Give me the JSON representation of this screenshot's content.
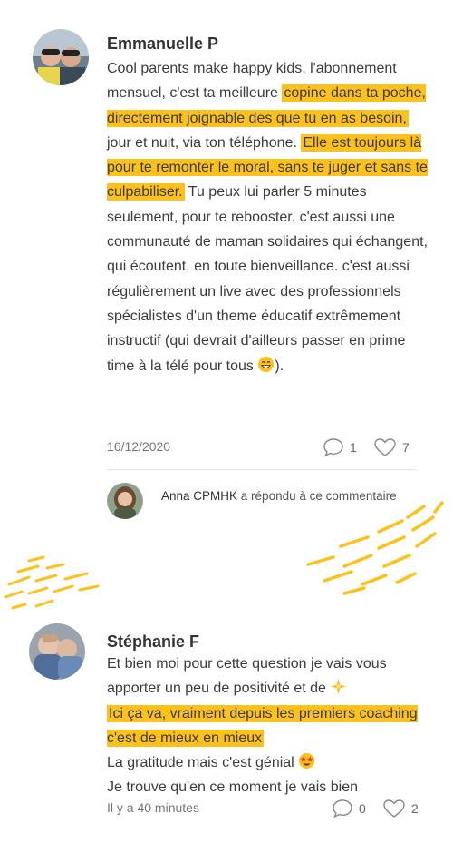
{
  "comments": [
    {
      "author": "Emmanuelle P",
      "segments": [
        {
          "t": "Cool parents make happy kids, l'abonnement mensuel, c'est ta meilleure ",
          "hl": false
        },
        {
          "t": "copine dans ta poche, directement joignable des que tu en as besoin,",
          "hl": true
        },
        {
          "t": " jour et nuit, via ton téléphone. ",
          "hl": false
        },
        {
          "t": "Elle est toujours là pour te remonter le moral, sans te juger et sans te culpabiliser.",
          "hl": true
        },
        {
          "t": " Tu peux lui parler 5 minutes seulement, pour te rebooster. c'est aussi une communauté de maman solidaires qui échangent, qui écoutent, en toute bienveillance. c'est aussi régulièrement un live avec des professionnels spécialistes d'un theme éducatif extrêmement instructif (qui devrait d'ailleurs passer en prime time à la télé pour tous ",
          "hl": false
        },
        {
          "t": "",
          "hl": false,
          "emoji": "grin"
        },
        {
          "t": ").",
          "hl": false
        }
      ],
      "date": "16/12/2020",
      "reply_count": "1",
      "like_count": "7",
      "reply": {
        "name": "Anna CPMHK",
        "text": " a répondu à ce commentaire"
      }
    },
    {
      "author": "Stéphanie F",
      "segments": [
        {
          "t": "Et bien moi pour cette question je vais vous apporter un peu de positivité et de ",
          "hl": false
        },
        {
          "t": "",
          "hl": false,
          "emoji": "sparkle"
        },
        {
          "t": " ",
          "hl": false,
          "br": true
        },
        {
          "t": "Ici ça va, vraiment depuis les premiers coaching c'est de mieux en mieux",
          "hl": true
        },
        {
          "t": " ",
          "hl": false,
          "br": true
        },
        {
          "t": "La gratitude mais c'est génial ",
          "hl": false
        },
        {
          "t": "",
          "hl": false,
          "emoji": "starstruck"
        },
        {
          "t": " ",
          "hl": false,
          "br": true
        },
        {
          "t": "Je trouve qu'en ce moment je vais bien",
          "hl": false
        }
      ],
      "date": "Il y a 40 minutes",
      "reply_count": "0",
      "like_count": "2"
    }
  ],
  "colors": {
    "highlight": "#fcc21b",
    "text": "#3c3c3c",
    "meta": "#777777"
  }
}
